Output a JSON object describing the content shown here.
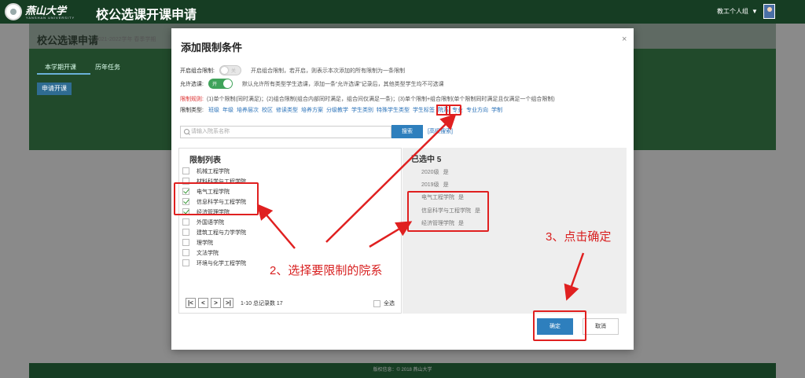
{
  "app": {
    "university": "燕山大学",
    "university_en": "YANSHAN UNIVERSITY",
    "title": "校公选课开课申请",
    "user": "教工个人组",
    "user_caret": "▼"
  },
  "page": {
    "title": "校公选课申请",
    "subtitle": "2021-2022学年 春季学期",
    "tabs": [
      "本学期开课",
      "历年任务"
    ],
    "apply_button": "申请开课",
    "footer": "版权信息：© 2018 燕山大学"
  },
  "modal": {
    "title": "添加限制条件",
    "close": "×",
    "combo_label": "开启组合限制:",
    "combo_toggle": "关",
    "combo_note": "开启组合限制，若开启，则表示本次添加的所有限制为一条限制",
    "allow_label": "允许选课:",
    "allow_toggle": "开",
    "allow_note": "默认允许所有类型学生选课，添加一条“允许选课”记录后，其他类型学生均不可选课",
    "rule_label": "限制规则:",
    "rule_text": "(1)单个限制(同时满足)；(2)组合限制(组合内部同时满足，组合间仅满足一条)；(3)单个限制+组合限制(单个限制同时满足且仅满足一个组合限制)",
    "type_label": "限制类型:",
    "types": [
      "班级",
      "年级",
      "培养层次",
      "校区",
      "修读类型",
      "培养方案",
      "分级教学",
      "学生类别",
      "特殊学生类型",
      "学生标签",
      "院系",
      "专业",
      "专业方向",
      "学制"
    ],
    "selected_type": "院系",
    "search_placeholder": "请输入院系名称",
    "search_button": "搜索",
    "advanced_search": "[高级搜索]",
    "list_title": "限制列表",
    "list_items": [
      {
        "name": "机械工程学院",
        "checked": false
      },
      {
        "name": "材料科学与工程学院",
        "checked": false
      },
      {
        "name": "电气工程学院",
        "checked": true
      },
      {
        "name": "信息科学与工程学院",
        "checked": true
      },
      {
        "name": "经济管理学院",
        "checked": true
      },
      {
        "name": "外国语学院",
        "checked": false
      },
      {
        "name": "建筑工程与力学学院",
        "checked": false
      },
      {
        "name": "理学院",
        "checked": false
      },
      {
        "name": "文法学院",
        "checked": false
      },
      {
        "name": "环境与化学工程学院",
        "checked": false
      }
    ],
    "pager": {
      "first": "|<",
      "prev": "<",
      "next": ">",
      "last": ">|",
      "info": "1-10 总记录数 17"
    },
    "select_all": "全选",
    "selected_title": "已选中 5",
    "selected_items": [
      {
        "name": "2020级",
        "value": "是"
      },
      {
        "name": "2019级",
        "value": "是"
      },
      {
        "name": "电气工程学院",
        "value": "是"
      },
      {
        "name": "信息科学与工程学院",
        "value": "是"
      },
      {
        "name": "经济管理学院",
        "value": "是"
      }
    ],
    "ok_button": "确定",
    "cancel_button": "取消"
  },
  "annotations": {
    "step2": "2、选择要限制的院系",
    "step3": "3、点击确定",
    "color": "#e02020"
  },
  "colors": {
    "header_green": "#163d23",
    "primary_blue": "#2e7fbd",
    "toggle_on": "#3fa35a",
    "link_blue": "#2a72b9"
  }
}
